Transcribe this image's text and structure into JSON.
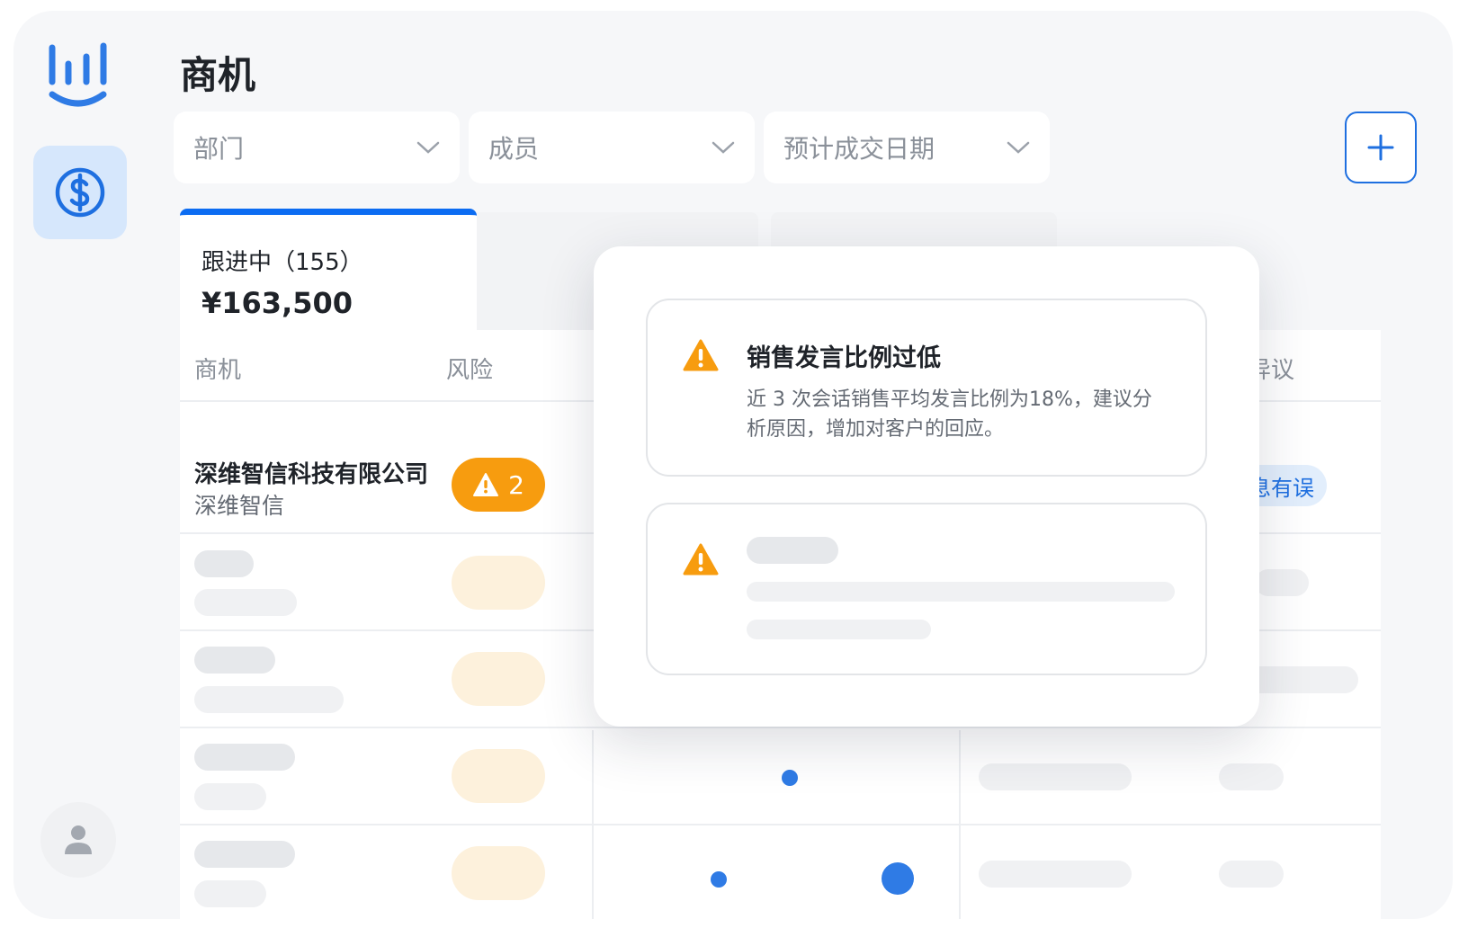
{
  "page": {
    "title": "商机"
  },
  "filters": [
    {
      "label": "部门"
    },
    {
      "label": "成员"
    },
    {
      "label": "预计成交日期"
    }
  ],
  "stage": {
    "label": "跟进中（155）",
    "amount": "¥163,500"
  },
  "table": {
    "headers": [
      "商机",
      "风险",
      "异议"
    ],
    "row": {
      "company": "深维智信科技有限公司",
      "short_name": "深维智信",
      "risk_count": "2",
      "tag": "息有误"
    }
  },
  "popover": {
    "alert": {
      "title": "销售发言比例过低",
      "body": "近 3 次会话销售平均发言比例为18%，建议分析原因，增加对客户的回应。"
    }
  },
  "colors": {
    "primary": "#0c6cf2",
    "warning": "#f79c0f",
    "nav_active_bg": "#d6e7fc"
  },
  "icons": {
    "logo": "bar-chart-smile-logo",
    "nav": "dollar-circle-icon",
    "add": "plus-icon",
    "warning": "warning-triangle-icon",
    "user": "user-icon"
  }
}
